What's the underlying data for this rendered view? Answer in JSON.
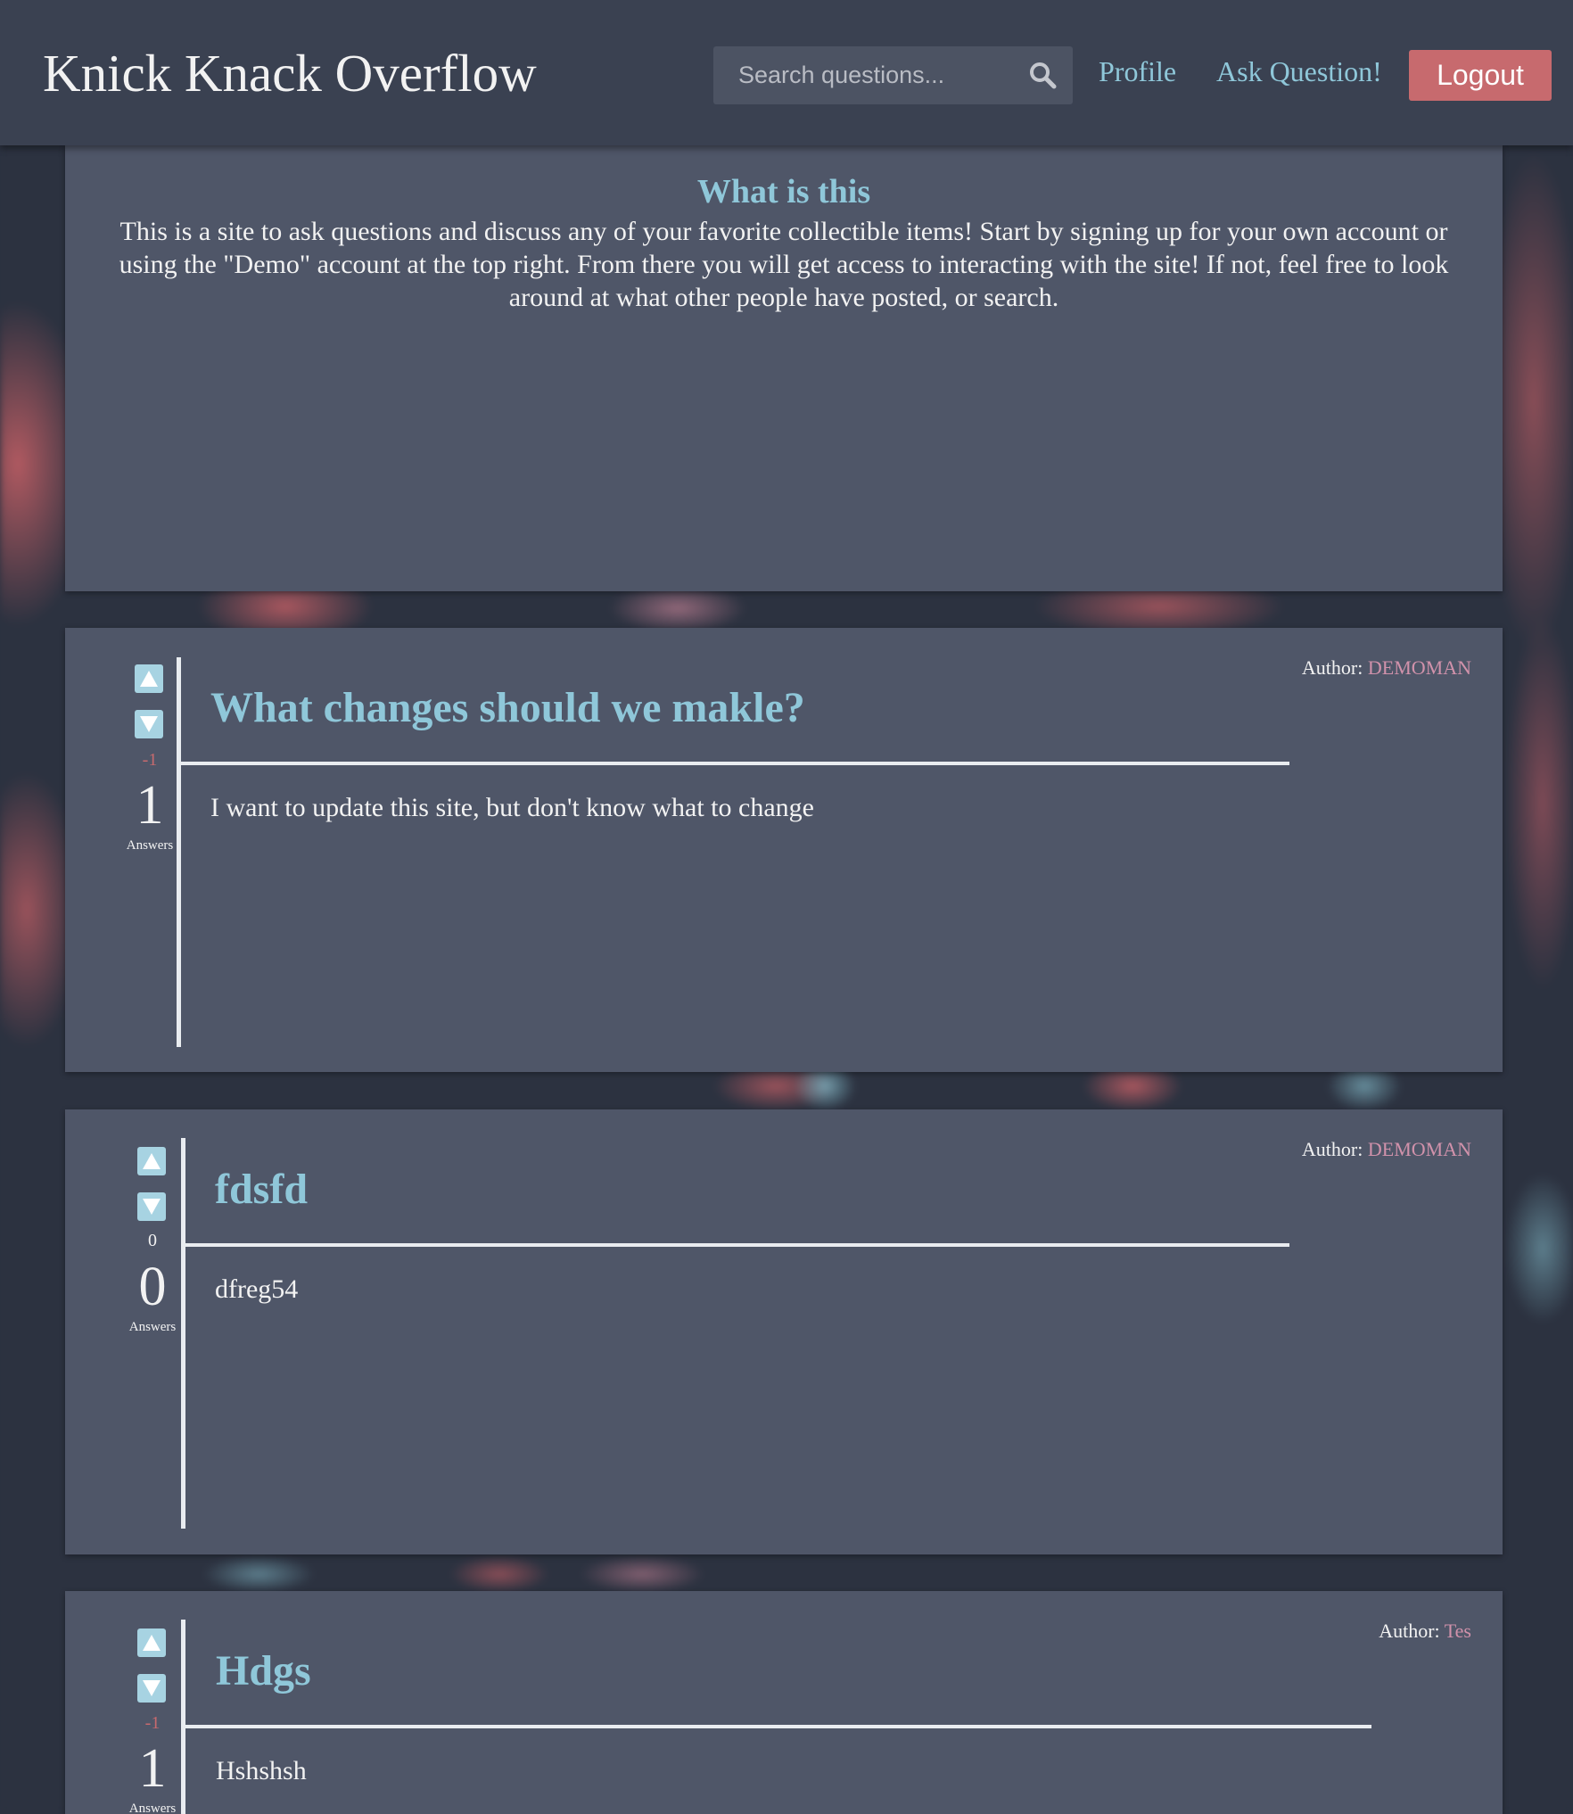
{
  "navbar": {
    "brand": "Knick Knack Overflow",
    "search_placeholder": "Search questions...",
    "profile_label": "Profile",
    "ask_label": "Ask Question!",
    "logout_label": "Logout"
  },
  "intro": {
    "title": "What is this",
    "text": "This is a site to ask questions and discuss any of your favorite collectible items! Start by signing up for your own account or using the \"Demo\" account at the top right. From there you will get access to interacting with the site! If not, feel free to look around at what other people have posted, or search."
  },
  "answers_label": "Answers",
  "author_prefix": "Author:",
  "questions": [
    {
      "score": "-1",
      "answers": "1",
      "title": "What changes should we makle?",
      "body": "I want to update this site, but don't know what to change",
      "author": "DEMOMAN"
    },
    {
      "score": "0",
      "answers": "0",
      "title": "fdsfd",
      "body": "dfreg54",
      "author": "DEMOMAN"
    },
    {
      "score": "-1",
      "answers": "1",
      "title": "Hdgs",
      "body": "Hshshsh",
      "author": "Tes"
    }
  ],
  "colors": {
    "accent_blue": "#8fc7d9",
    "author_pink": "#d192ab",
    "negative_score": "#c76a6e",
    "logout_button": "#c76a6e",
    "panel": "#4f5668",
    "navbar": "#3a4151"
  },
  "icons": [
    "search-icon",
    "upvote-icon",
    "downvote-icon"
  ]
}
